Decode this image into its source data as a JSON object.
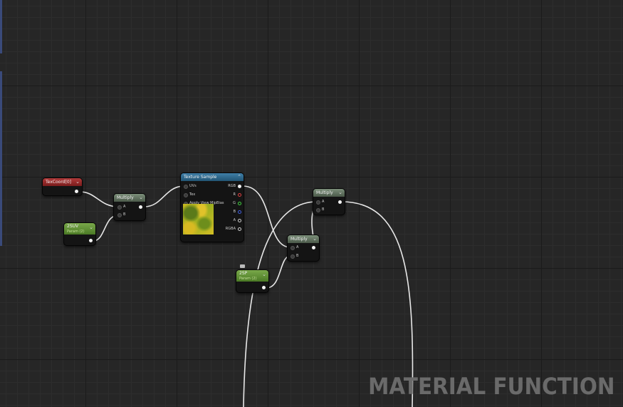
{
  "nodes": {
    "texcoord": {
      "title": "TexCoord[0]"
    },
    "multiply1": {
      "title": "Multiply",
      "pin_a": "A",
      "pin_b": "B"
    },
    "param_uv": {
      "title": "2SUV",
      "subtitle": "Param (2)"
    },
    "texture_sample": {
      "title": "Texture Sample",
      "inputs": [
        "UVs",
        "Tex",
        "Apply View MipBias"
      ],
      "outputs": [
        "RGB",
        "R",
        "G",
        "B",
        "A",
        "RGBA"
      ]
    },
    "multiply2": {
      "title": "Multiply",
      "pin_a": "A",
      "pin_b": "B"
    },
    "multiply3": {
      "title": "Multiply",
      "pin_a": "A",
      "pin_b": "B"
    },
    "param_sp": {
      "title": "2SP",
      "subtitle": "Param (2)"
    }
  },
  "watermark": "MATERIAL FUNCTION",
  "colors": {
    "background": "#262626",
    "wire": "#e8e8e8",
    "header_red": "#9a2c2c",
    "header_gray": "#6a7d68",
    "header_blue": "#2f6a90",
    "header_green": "#5f8f33",
    "pin_r": "#e04040",
    "pin_g": "#40d040",
    "pin_b": "#4060e0"
  },
  "icons": [
    "chevron-down-icon",
    "chevron-up-icon",
    "comment-icon"
  ]
}
